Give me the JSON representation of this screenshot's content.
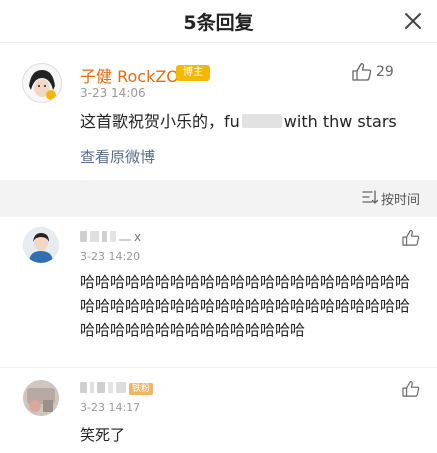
{
  "header": {
    "title": "5条回复"
  },
  "main_post": {
    "username": "子健 RockZO",
    "badge": "博主",
    "time": "3-23 14:06",
    "likes": "29",
    "content_prefix": "这首歌祝贺小乐的，fu",
    "content_suffix": "with thw stars",
    "view_original": "查看原微博"
  },
  "sort": {
    "label": "按时间"
  },
  "comments": [
    {
      "username_visible": "x",
      "time": "3-23 14:20",
      "text": "哈哈哈哈哈哈哈哈哈哈哈哈哈哈哈哈哈哈哈哈哈哈哈哈哈哈哈哈哈哈哈哈哈哈哈哈哈哈哈哈哈哈哈哈哈哈哈哈哈哈哈哈哈哈哈哈哈哈哈"
    },
    {
      "tag": "铁粉",
      "time": "3-23 14:17",
      "text": "笑死了"
    }
  ],
  "colors": {
    "username_main": "#e86b0f",
    "link": "#5b6e8f",
    "badge": "#f5b800"
  },
  "icons": [
    "close-icon",
    "thumbs-up-icon",
    "sort-icon"
  ]
}
